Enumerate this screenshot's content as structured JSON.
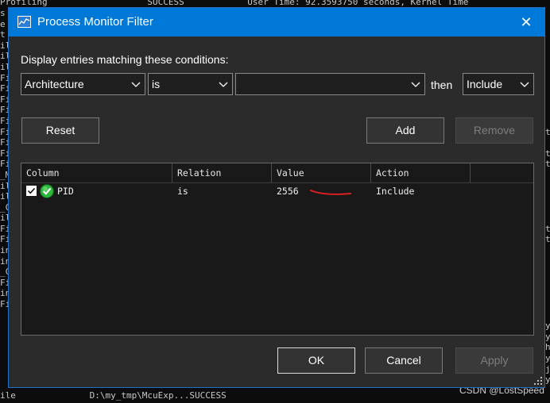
{
  "background": {
    "top_line": "Profiling                   SUCCESS            User Time: 92.3593750 seconds, Kernel Time",
    "bottom_line": "ile              D:\\my_tmp\\McuExp...SUCCESS",
    "left_column": "s\ne\nt\nil\nil\nil\nFi\nFi\nFi\nFi\nFi\nFi\nFi\nFi\nFi\n_M\nil\nil\n_C\nil\nFi\nFi\nin\nin\n_C\nFi\nin\nFi",
    "right_column": "\n\n\n\n\n\n\n\n\n\n\nt\n\nt\nt\n\n\n\n\n\nt\nt\n\n\n\n\n\n\n\ny\ny\nh\ny\nj\ny",
    "watermark": "CSDN @LostSpeed"
  },
  "dialog": {
    "title": "Process Monitor Filter",
    "close_glyph": "✕",
    "conditions_label": "Display entries matching these conditions:",
    "column_select": "Architecture",
    "relation_select": "is",
    "value_input": "",
    "then_label": "then",
    "action_select": "Include",
    "reset_label": "Reset",
    "add_label": "Add",
    "remove_label": "Remove",
    "ok_label": "OK",
    "cancel_label": "Cancel",
    "apply_label": "Apply"
  },
  "table": {
    "columns": [
      "Column",
      "Relation",
      "Value",
      "Action"
    ],
    "rows": [
      {
        "checked": true,
        "column": "PID",
        "relation": "is",
        "value": "2556",
        "action": "Include"
      }
    ]
  },
  "colors": {
    "titlebar": "#0078d7",
    "dialog_bg": "#2b2b2b",
    "annotation_red": "#e02020",
    "ok_icon_green": "#2db83d"
  }
}
